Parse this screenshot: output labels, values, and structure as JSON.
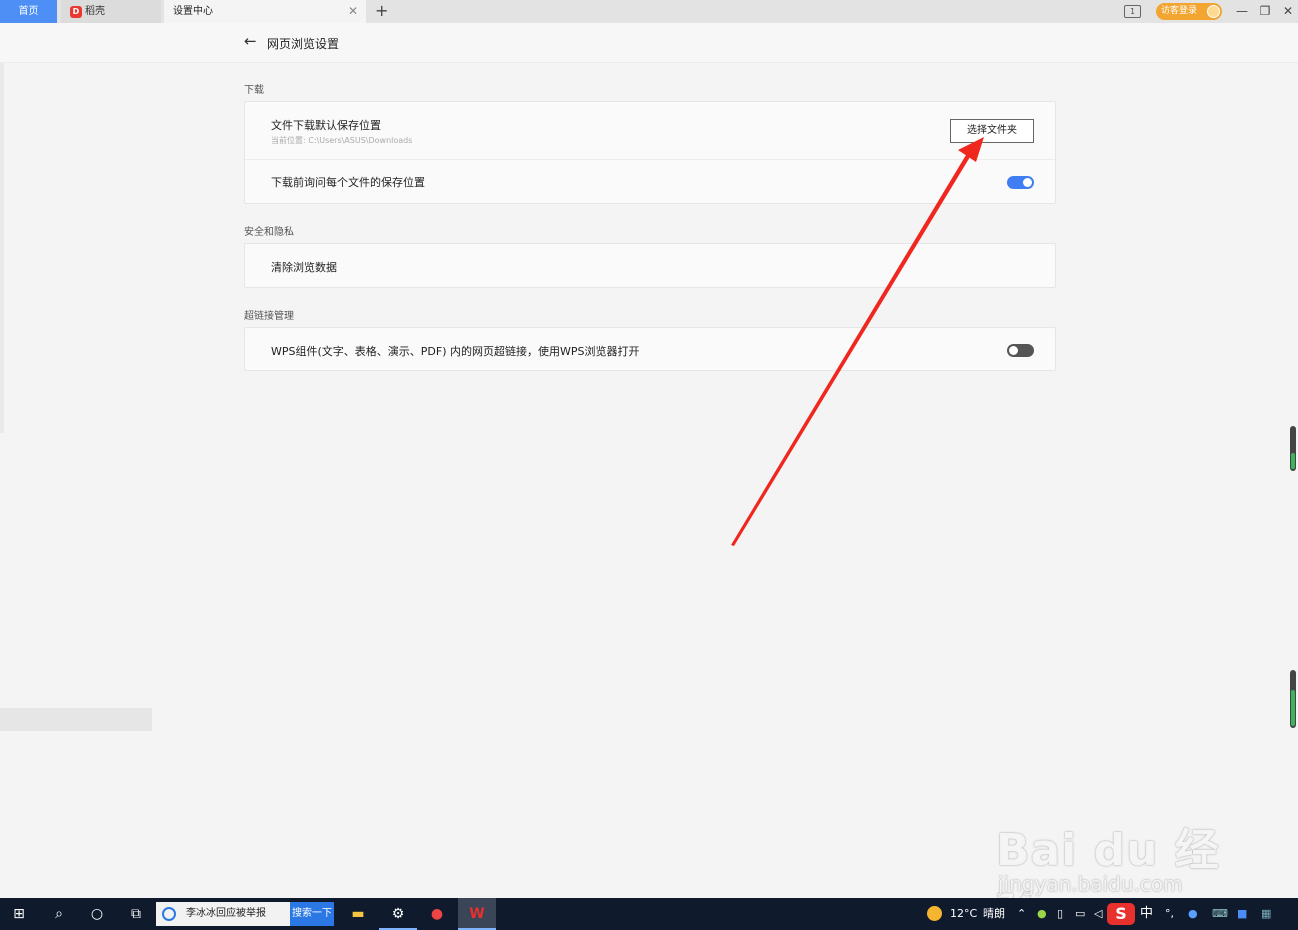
{
  "tabs": {
    "home": "首页",
    "daoke": "稻壳",
    "settings": "设置中心",
    "close_glyph": "✕",
    "add_glyph": "+"
  },
  "titlebar": {
    "guest_login": "访客登录",
    "reader_icon": "reader-mode-icon",
    "minimize": "—",
    "restore": "❐",
    "close": "✕"
  },
  "header": {
    "back_icon": "arrow-left-icon",
    "title": "网页浏览设置"
  },
  "sections": {
    "download": {
      "title": "下载",
      "default_location_label": "文件下载默认保存位置",
      "current_location": "当前位置: C:\\Users\\ASUS\\Downloads",
      "choose_folder": "选择文件夹",
      "ask_each_label": "下载前询问每个文件的保存位置",
      "ask_each_enabled": true
    },
    "privacy": {
      "title": "安全和隐私",
      "clear_data_label": "清除浏览数据"
    },
    "hyperlink": {
      "title": "超链接管理",
      "wps_open_label": "WPS组件(文字、表格、演示、PDF) 内的网页超链接，使用WPS浏览器打开",
      "wps_open_enabled": false
    }
  },
  "annotation": {
    "arrow_color": "#f0271f"
  },
  "watermark": {
    "main": "Bai du 经验",
    "sub": "jingyan.baidu.com"
  },
  "taskbar": {
    "search_text": "李冰冰回应被举报",
    "search_button": "搜索一下",
    "weather_temp": "12°C",
    "weather_text": "晴朗",
    "ime_lang": "中"
  },
  "colors": {
    "accent": "#3f7ef2",
    "home_tab": "#4e8ff5",
    "guest_button": "#f2a531",
    "taskbar": "#0f1b2d"
  }
}
